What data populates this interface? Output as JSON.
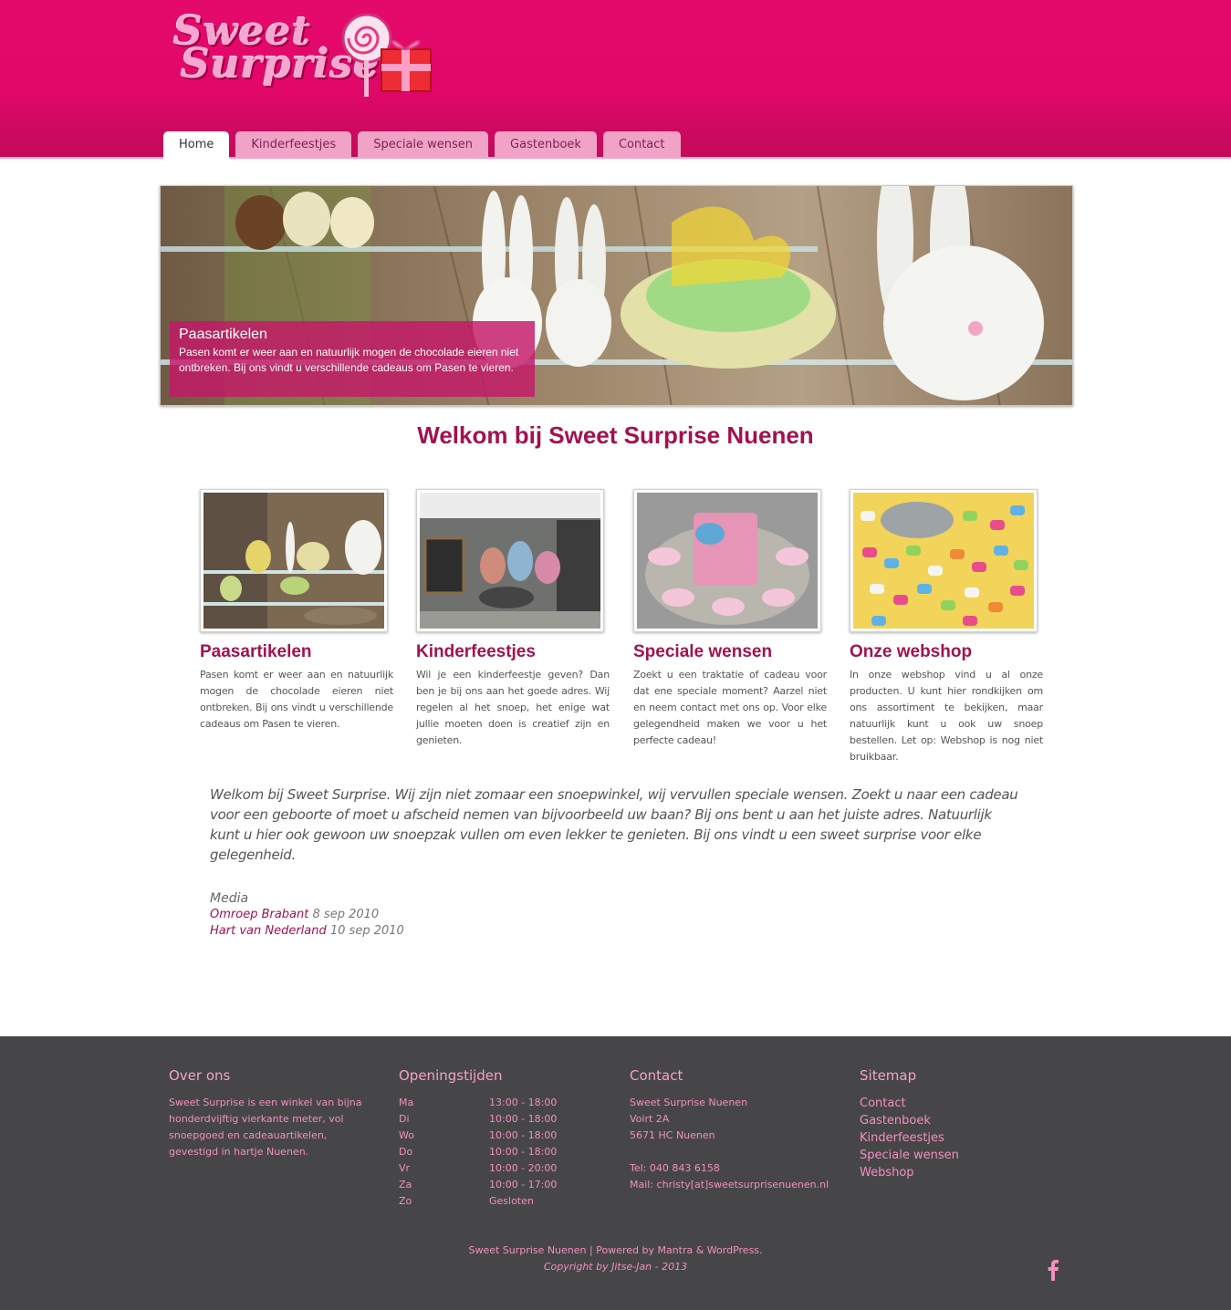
{
  "header": {
    "logo_line1": "Sweet",
    "logo_line2": "Surprise",
    "nav": [
      "Home",
      "Kinderfeestjes",
      "Speciale wensen",
      "Gastenboek",
      "Contact"
    ]
  },
  "slider": {
    "title": "Paasartikelen",
    "text": "Pasen komt er weer aan en natuurlijk mogen de chocolade eieren niet ontbreken. Bij ons vindt u verschillende cadeaus om Pasen te vieren."
  },
  "main": {
    "heading": "Welkom bij Sweet Surprise Nuenen",
    "features": [
      {
        "title": "Paasartikelen",
        "text": "Pasen komt er weer aan en natuurlijk mogen de chocolade eieren niet ontbreken. Bij ons vindt u verschillende cadeaus om Pasen te vieren."
      },
      {
        "title": "Kinderfeestjes",
        "text": "Wil je een kinderfeestje geven? Dan ben je bij ons aan het goede adres. Wij regelen al het snoep, het enige wat jullie moeten doen is creatief zijn en genieten."
      },
      {
        "title": "Speciale wensen",
        "text": "Zoekt u een traktatie of cadeau voor dat ene speciale moment? Aarzel niet en neem contact met ons op. Voor elke gelegendheid maken we voor u het perfecte cadeau!"
      },
      {
        "title": "Onze webshop",
        "text": "In onze webshop vind u al onze producten. U kunt hier rondkijken om ons assortiment te bekijken, maar natuurlijk kunt u ook uw snoep bestellen. Let op: Webshop is nog niet bruikbaar."
      }
    ],
    "intro": "Welkom bij Sweet Surprise. Wij zijn niet zomaar een snoepwinkel, wij vervullen speciale wensen. Zoekt u naar een cadeau voor een geboorte of moet u afscheid nemen van bijvoorbeeld uw baan? Bij ons bent u aan het juiste adres. Natuurlijk kunt u hier ook gewoon uw snoepzak vullen om even lekker te genieten. Bij ons vindt u een sweet surprise voor elke gelegenheid.",
    "media": {
      "title": "Media",
      "items": [
        {
          "link": "Omroep Brabant",
          "date": "8 sep 2010"
        },
        {
          "link": "Hart van Nederland",
          "date": "10 sep 2010"
        }
      ]
    }
  },
  "footer": {
    "about": {
      "title": "Over ons",
      "text": "Sweet Surprise is een winkel van bijna honderdvijftig vierkante meter, vol snoepgoed en cadeauartikelen, gevestigd in hartje Nuenen."
    },
    "hours": {
      "title": "Openingstijden",
      "rows": [
        {
          "day": "Ma",
          "time": "13:00 - 18:00"
        },
        {
          "day": "Di",
          "time": "10:00 - 18:00"
        },
        {
          "day": "Wo",
          "time": "10:00 - 18:00"
        },
        {
          "day": "Do",
          "time": "10:00 - 18:00"
        },
        {
          "day": "Vr",
          "time": "10:00 - 20:00"
        },
        {
          "day": "Za",
          "time": "10:00 - 17:00"
        },
        {
          "day": "Zo",
          "time": "Gesloten"
        }
      ]
    },
    "contact": {
      "title": "Contact",
      "name": "Sweet Surprise Nuenen",
      "street": "Voirt 2A",
      "city": "5671 HC Nuenen",
      "tel": "Tel: 040 843 6158",
      "mail": "Mail: christy[at]sweetsurprisenuenen.nl"
    },
    "sitemap": {
      "title": "Sitemap",
      "links": [
        "Contact",
        "Gastenboek",
        "Kinderfeestjes",
        "Speciale wensen",
        "Webshop"
      ]
    },
    "bottom_line": "Sweet Surprise Nuenen | Powered by Mantra & WordPress.",
    "copyright": "Copyright by Jitse-Jan - 2013",
    "social_icon": "facebook-icon"
  },
  "colors": {
    "brand_pink": "#e40a6c",
    "heading": "#a2124f",
    "footer_bg": "#464648",
    "footer_text": "#f28fbf"
  }
}
